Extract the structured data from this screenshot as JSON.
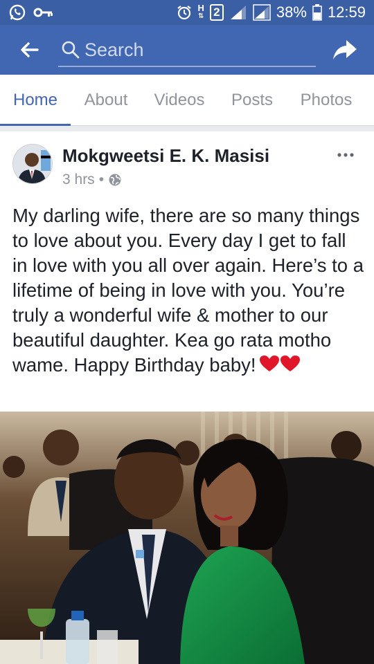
{
  "status_bar": {
    "battery": "38%",
    "time": "12:59",
    "network_h": "H",
    "sim": "2"
  },
  "header": {
    "search_placeholder": "Search"
  },
  "tabs": [
    {
      "label": "Home",
      "active": true
    },
    {
      "label": "About",
      "active": false
    },
    {
      "label": "Videos",
      "active": false
    },
    {
      "label": "Posts",
      "active": false
    },
    {
      "label": "Photos",
      "active": false
    }
  ],
  "post": {
    "author": "Mokgweetsi E. K. Masisi",
    "time_ago": "3 hrs",
    "separator": "•",
    "privacy_icon": "globe-icon",
    "text": "My darling wife, there are so many things to love about you. Every day I get to fall in love with you all over again. Here’s to a lifetime of being in love with you. You’re truly a wonderful wife & mother to our beautiful daughter. Kea go rata motho wame. Happy Birthday baby!",
    "emoji": "heart-emoji x2"
  },
  "colors": {
    "brand": "#4267b2",
    "status_bar": "#3b5fa4",
    "heart": "#e0162b"
  }
}
